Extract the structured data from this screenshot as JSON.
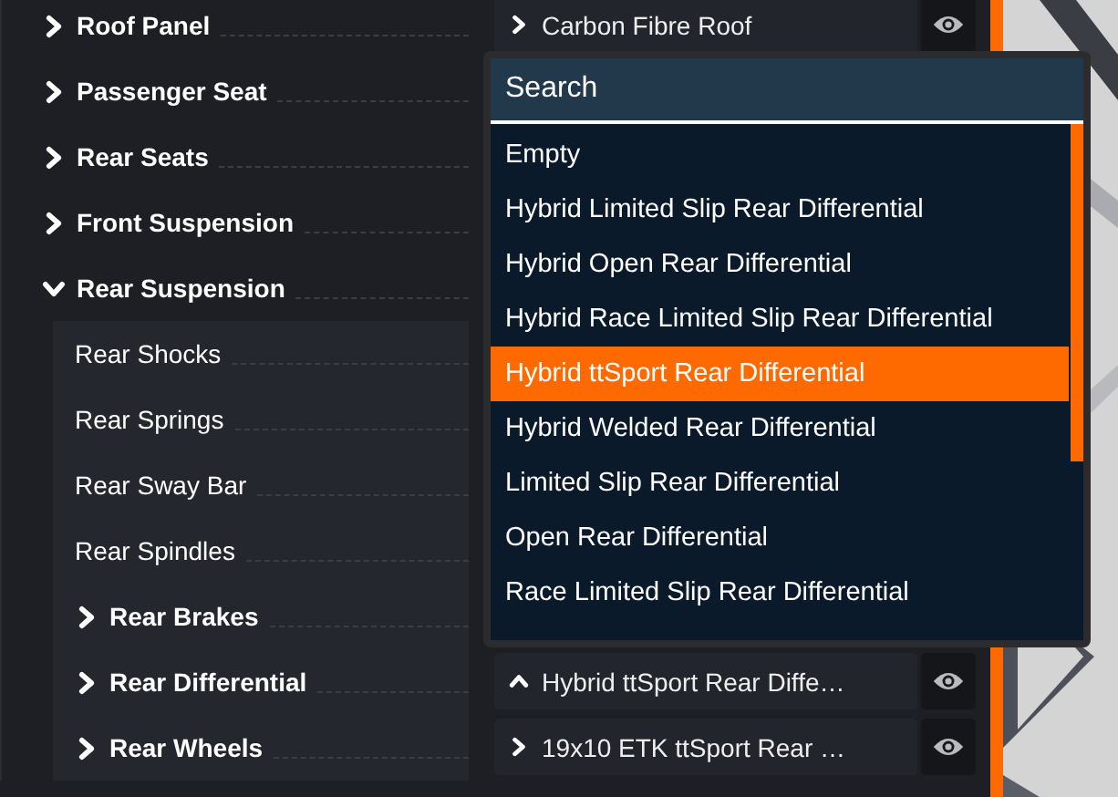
{
  "tree": [
    {
      "label": "Roof Panel",
      "kind": "group",
      "expanded": false,
      "value": {
        "text": "Carbon Fibre Roof",
        "expanded": false
      }
    },
    {
      "label": "Passenger Seat",
      "kind": "group",
      "expanded": false
    },
    {
      "label": "Rear Seats",
      "kind": "group",
      "expanded": false
    },
    {
      "label": "Front Suspension",
      "kind": "group",
      "expanded": false
    },
    {
      "label": "Rear Suspension",
      "kind": "group",
      "expanded": true,
      "children": [
        {
          "label": "Rear Shocks",
          "kind": "leaf"
        },
        {
          "label": "Rear Springs",
          "kind": "leaf"
        },
        {
          "label": "Rear Sway Bar",
          "kind": "leaf"
        },
        {
          "label": "Rear Spindles",
          "kind": "leaf"
        },
        {
          "label": "Rear Brakes",
          "kind": "group",
          "expanded": false
        },
        {
          "label": "Rear Differential",
          "kind": "group",
          "expanded": false,
          "value": {
            "text": "Hybrid ttSport Rear Diffe…",
            "expanded": true
          }
        },
        {
          "label": "Rear Wheels",
          "kind": "group",
          "expanded": false,
          "value": {
            "text": "19x10 ETK ttSport Rear …",
            "expanded": false
          }
        }
      ]
    }
  ],
  "dropdown": {
    "search": {
      "placeholder": "Search"
    },
    "options": [
      {
        "label": "Empty",
        "selected": false
      },
      {
        "label": "Hybrid Limited Slip Rear Differential",
        "selected": false
      },
      {
        "label": "Hybrid Open Rear Differential",
        "selected": false
      },
      {
        "label": "Hybrid Race Limited Slip Rear Differential",
        "selected": false
      },
      {
        "label": "Hybrid ttSport Rear Differential",
        "selected": true
      },
      {
        "label": "Hybrid Welded Rear Differential",
        "selected": false
      },
      {
        "label": "Limited Slip Rear Differential",
        "selected": false
      },
      {
        "label": "Open Rear Differential",
        "selected": false
      },
      {
        "label": "Race Limited Slip Rear Differential",
        "selected": false
      }
    ]
  }
}
